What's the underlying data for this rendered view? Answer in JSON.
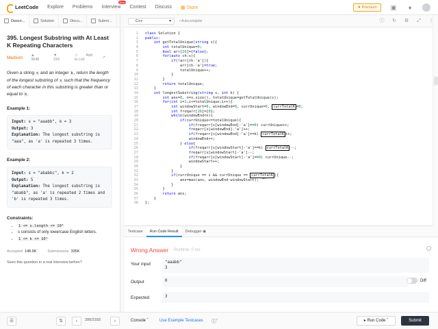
{
  "nav": {
    "logo": "LeetCode",
    "links": [
      "Explore",
      "Problems",
      "Interview",
      "Contest",
      "Discuss"
    ],
    "new_badge": "New",
    "store": "Store",
    "premium": "Premium"
  },
  "left_tabs": [
    "Descri...",
    "Solution",
    "Discu...",
    "Submi..."
  ],
  "problem": {
    "title": "395. Longest Substring with At Least K Repeating Characters",
    "difficulty": "Medium",
    "likes": "3648",
    "dislikes": "316",
    "add_to_list": "Add to List",
    "desc_1": "Given a string ",
    "desc_s": "s",
    "desc_2": " and an integer ",
    "desc_k": "k",
    "desc_3": ", return the length of the longest substring of ",
    "desc_s2": "s",
    "desc_4": " such that the frequency of each character in this substring is greater than or equal to ",
    "desc_k2": "k",
    "desc_5": ".",
    "example1_title": "Example 1:",
    "example1": {
      "input_label": "Input:",
      "input": " s = \"aaabb\", k = 3",
      "output_label": "Output:",
      "output": " 3",
      "expl_label": "Explanation:",
      "expl": " The longest substring is \"aaa\", as 'a' is repeated 3 times."
    },
    "example2_title": "Example 2:",
    "example2": {
      "input_label": "Input:",
      "input": " s = \"ababbc\", k = 2",
      "output_label": "Output:",
      "output": " 5",
      "expl_label": "Explanation:",
      "expl": " The longest substring is \"ababb\", as 'a' is repeated 2 times and 'b' is repeated 3 times."
    },
    "constraints_title": "Constraints:",
    "constraints": [
      "1 <= s.length <= 10⁴",
      "s consists of only lowercase English letters.",
      "1 <= k <= 10⁵"
    ],
    "accepted_label": "Accepted",
    "accepted": "148.9K",
    "submissions_label": "Submissions",
    "submissions": "335K",
    "seen": "Seen this question in a real interview before?"
  },
  "left_bottom": {
    "pager": "395/2183"
  },
  "editor": {
    "language": "C++",
    "autocomplete": "Autocomplete",
    "lines": [
      "class Solution {",
      "public:",
      "    int getTotalUnique(string s){",
      "        int totalUnique=0;",
      "        bool arr[26]={false};",
      "        for(auto ch:s){",
      "            if(!arr[ch-'a']){",
      "                arr[ch-'a']=true;",
      "                totalUnique++;",
      "            }",
      "        }",
      "        return totalUnique;",
      "    }",
      "    int longestSubstring(string s, int k) {",
      "        int ans=0, n=s.size(), totalUnique=getTotalUnique(s);",
      "        for(int i=1;i<=totalUnique;i++){",
      "            int windowStart=0, windowEnd=0, currUnique=0, currTotalK=0;",
      "            int freqarr[26]={0};",
      "            while(windowEnd<n){",
      "                if(currUnique<=totalUnique){",
      "                    if(freqarr[s[windowEnd]-'a']==0) currUnique++;",
      "                    freqarr[s[windowEnd]-'a']++;",
      "                    if(freqarr[s[windowEnd]-'a']==k) currTotalK++;",
      "                    windowEnd++;",
      "                } else{",
      "                    if(freqarr[s[windowStart]-'a']==k) currTotalK--;",
      "                    freqarr[s[windowStart]-'a']--;",
      "                    if(freqarr[s[windowStart]-'a']==0) currUnique--;",
      "                    windowStart++;",
      "                }",
      "            }",
      "            if(currUnique == i && currUnique == currTotalK){",
      "                ans=max(ans, windowEnd-windowStart);",
      "            }",
      "        }",
      "        return ans;",
      "    }",
      "};"
    ]
  },
  "console": {
    "tabs": [
      "Testcase",
      "Run Code Result",
      "Debugger"
    ],
    "status": "Wrong Answer",
    "runtime": "Runtime: 0 ms",
    "your_input_label": "Your input",
    "your_input_line1": "\"aaabb\"",
    "your_input_line2": "3",
    "output_label": "Output",
    "output_value": "0",
    "diff_label": "Diff",
    "expected_label": "Expected",
    "expected_value": "3"
  },
  "right_bottom": {
    "console": "Console",
    "use_example": "Use Example Testcases",
    "run_code": "Run Code",
    "submit": "Submit"
  }
}
